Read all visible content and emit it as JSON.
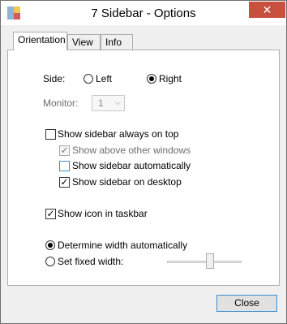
{
  "window": {
    "title": "7 Sidebar - Options",
    "close_glyph": "✕",
    "app_icon": "app-icon"
  },
  "tabs": [
    {
      "label": "Orientation",
      "active": true
    },
    {
      "label": "View",
      "active": false
    },
    {
      "label": "Info",
      "active": false
    }
  ],
  "orientation": {
    "side_label": "Side:",
    "side_options": [
      {
        "label": "Left",
        "selected": false
      },
      {
        "label": "Right",
        "selected": true
      }
    ],
    "monitor_label": "Monitor:",
    "monitor_value": "1",
    "checkboxes": [
      {
        "label": "Show sidebar always on top",
        "checked": false,
        "enabled": true
      },
      {
        "label": "Show above other windows",
        "checked": true,
        "enabled": false
      },
      {
        "label": "Show sidebar automatically",
        "checked": false,
        "enabled": true
      },
      {
        "label": "Show sidebar on desktop",
        "checked": true,
        "enabled": true
      },
      {
        "label": "Show icon in taskbar",
        "checked": true,
        "enabled": true
      }
    ],
    "width_options": [
      {
        "label": "Determine width automatically",
        "selected": true
      },
      {
        "label": "Set fixed width:",
        "selected": false
      }
    ]
  },
  "buttons": {
    "close_label": "Close"
  },
  "colors": {
    "accent": "#3c8fd1",
    "close_button_red": "#c7503f"
  }
}
